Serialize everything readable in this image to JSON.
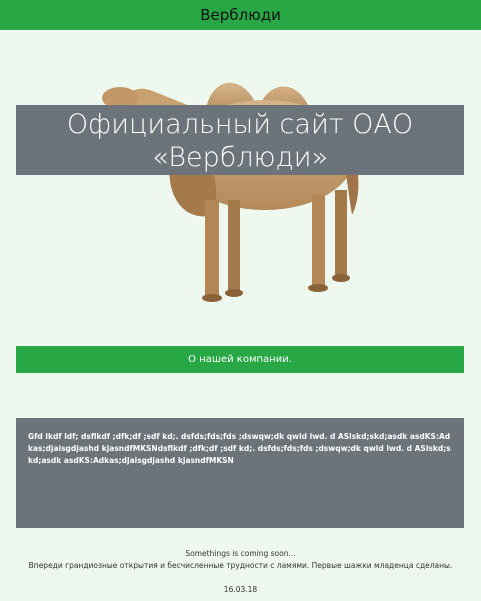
{
  "header": {
    "title": "Верблюди"
  },
  "hero": {
    "title_line1": "Официальный сайт ОАО",
    "title_line2": "«Верблюди»"
  },
  "about": {
    "label": "О нашей компании."
  },
  "content": {
    "text": "Gfd lkdf ldf; dsflkdf ;dfk;df ;sdf kd;. dsfds;fds;fds ;dswqw;dk qwld lwd. d ASlskd;skd;asdk asdKS:Adkas;djaisgdjashd kjasndfMKSNdsflkdf ;dfk;df ;sdf kd;. dsfds;fds;fds ;dswqw;dk qwld lwd. d ASlskd;skd;asdk asdKS:Adkas;djaisgdjashd kjasndfMKSN"
  },
  "footer": {
    "line1": "Somethings is coming soon...",
    "line2": "Впереди грандиозные открытия и бесчисленные трудности с ламями. Первые шажки младенца сделаны.",
    "date": "16.03.18"
  },
  "colors": {
    "accent": "#27a844",
    "panel": "#6c737a",
    "background": "#eef8ef"
  }
}
